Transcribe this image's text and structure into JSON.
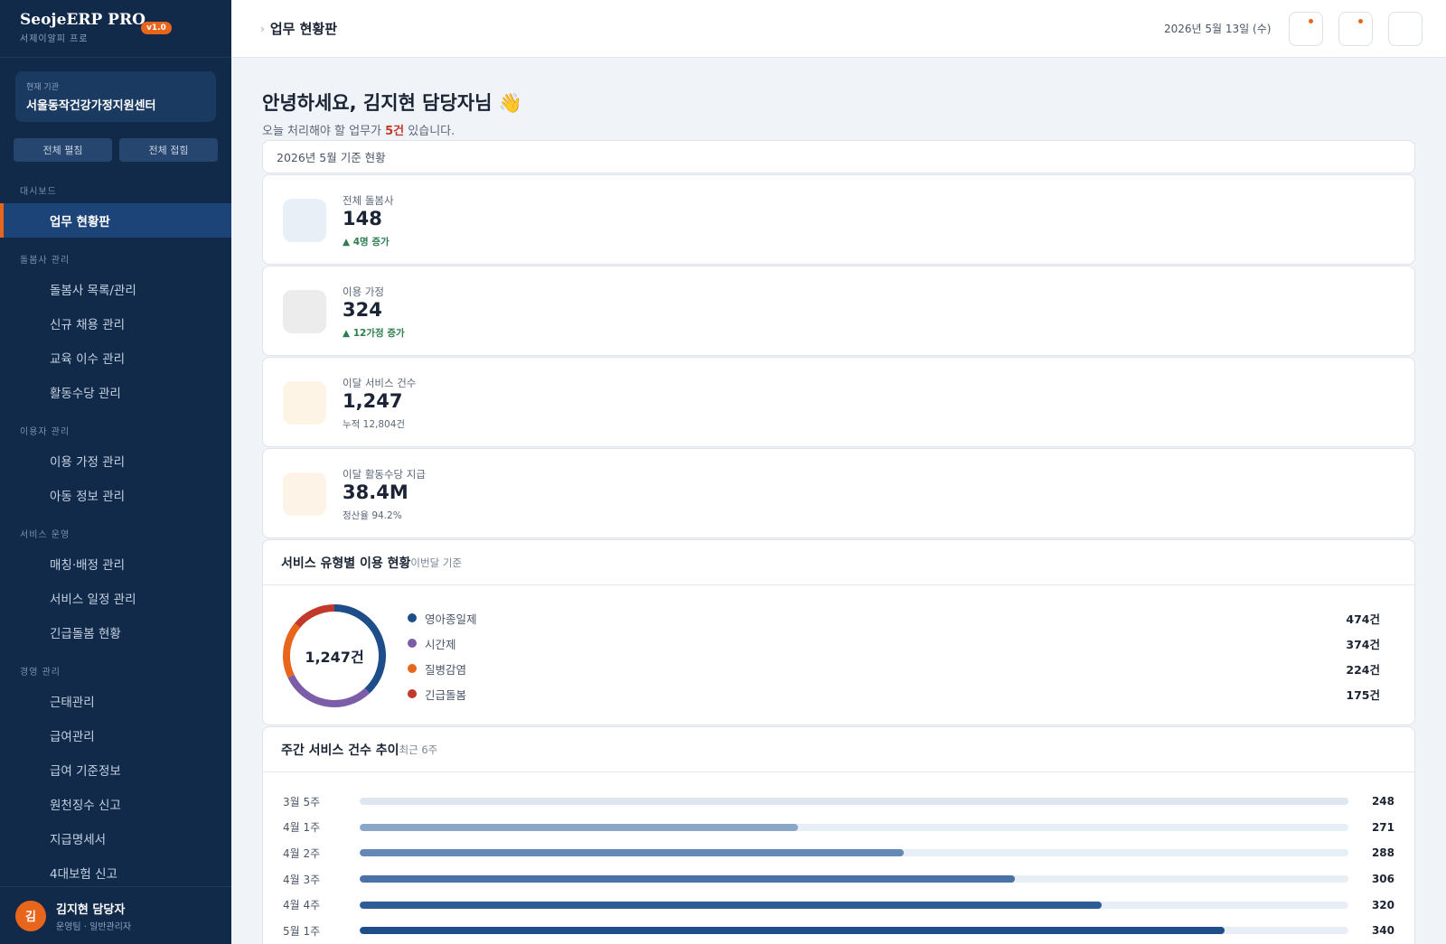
{
  "brand": {
    "title": "SeojeERP PRO",
    "version": "v1.0",
    "subtitle": "서제이알피 프로"
  },
  "org": {
    "label": "현재 기관",
    "name": "서울동작건강가정지원센터"
  },
  "sidebar_buttons": {
    "expand_all": "전체 펼침",
    "collapse_all": "전체 접힘"
  },
  "nav": {
    "dashboard": {
      "title": "대시보드",
      "items": [
        "업무 현황판"
      ]
    },
    "caregiver": {
      "title": "돌봄사 관리",
      "items": [
        "돌봄사 목록/관리",
        "신규 채용 관리",
        "교육 이수 관리",
        "활동수당 관리"
      ]
    },
    "user": {
      "title": "이용자 관리",
      "items": [
        "이용 가정 관리",
        "아동 정보 관리"
      ]
    },
    "service": {
      "title": "서비스 운영",
      "items": [
        "매칭·배정 관리",
        "서비스 일정 관리",
        "긴급돌봄 현황"
      ]
    },
    "management": {
      "title": "경영 관리",
      "items": [
        "근태관리",
        "급여관리",
        "급여 기준정보",
        "원천징수 신고",
        "지급명세서",
        "4대보험 신고"
      ]
    }
  },
  "user": {
    "initial": "김",
    "name": "김지현 담당자",
    "role": "운영팀 · 일반관리자"
  },
  "topbar": {
    "breadcrumb": "업무 현황판",
    "date": "2026년 5월 13일 (수)"
  },
  "greeting": {
    "title": "안녕하세요, 김지현 담당자님 👋",
    "sub_prefix": "오늘 처리해야 할 업무가 ",
    "sub_count": "5건",
    "sub_suffix": " 있습니다."
  },
  "period": "2026년 5월 기준 현황",
  "stats": [
    {
      "label": "전체 돌봄사",
      "value": "148",
      "foot": "▲ 4명 증가",
      "trend": "up",
      "icon_color": "#e9eff7"
    },
    {
      "label": "이용 가정",
      "value": "324",
      "foot": "▲ 12가정 증가",
      "trend": "up",
      "icon_color": "#ececec"
    },
    {
      "label": "이달 서비스 건수",
      "value": "1,247",
      "foot": "누적 12,804건",
      "trend": "none",
      "icon_color": "#fdf4e6"
    },
    {
      "label": "이달 활동수당 지급",
      "value": "38.4M",
      "foot": "정산율 94.2%",
      "trend": "none",
      "icon_color": "#fdf3e6"
    }
  ],
  "service_type": {
    "title": "서비스 유형별 이용 현황",
    "subtitle": "이번달 기준",
    "center_label": "1,247건",
    "chart_data": {
      "type": "pie",
      "title": "서비스 유형별 이용 현황",
      "categories": [
        "영아종일제",
        "시간제",
        "질병감염",
        "긴급돌봄"
      ],
      "values": [
        474,
        374,
        224,
        175
      ],
      "value_labels": [
        "474건",
        "374건",
        "224건",
        "175건"
      ],
      "colors": [
        "#1d4e89",
        "#7b5ea7",
        "#e8651c",
        "#c0392b"
      ],
      "total": 1247
    }
  },
  "weekly": {
    "title": "주간 서비스 건수 추이",
    "subtitle": "최근 6주",
    "chart_data": {
      "type": "bar",
      "title": "주간 서비스 건수 추이",
      "categories": [
        "3월 5주",
        "4월 1주",
        "4월 2주",
        "4월 3주",
        "4월 4주",
        "5월 1주"
      ],
      "values": [
        248,
        271,
        288,
        306,
        320,
        340
      ],
      "xlim": [
        200,
        360
      ],
      "colors": [
        "#dde6f1",
        "#8aa6c8",
        "#6688b5",
        "#4a72a6",
        "#2f5c95",
        "#1d4e89"
      ]
    }
  }
}
